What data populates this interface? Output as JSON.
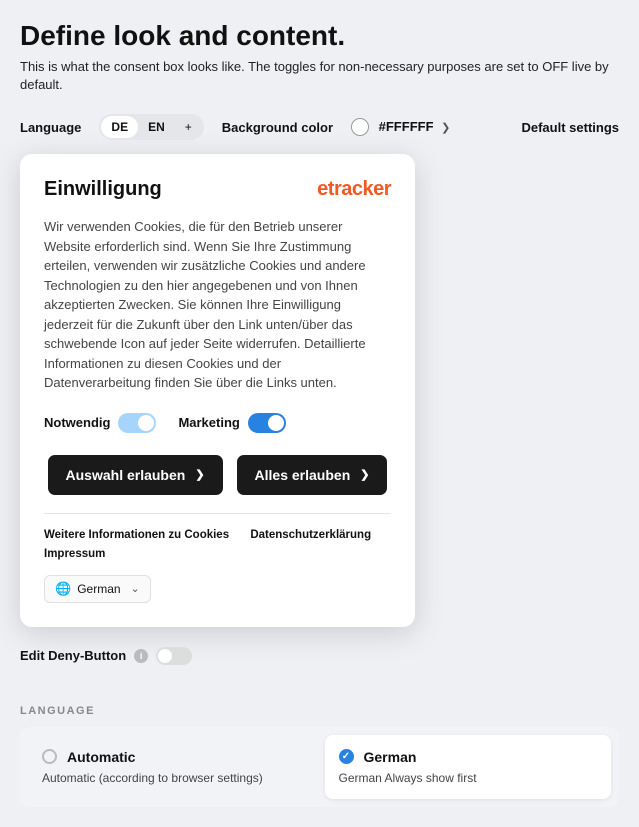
{
  "header": {
    "title": "Define look and content.",
    "subtitle": "This is what the consent box looks like. The toggles for non-necessary purposes are set to OFF live by default."
  },
  "toolbar": {
    "language_label": "Language",
    "lang_de": "DE",
    "lang_en": "EN",
    "lang_add": "+",
    "bg_label": "Background color",
    "bg_value": "#FFFFFF",
    "default_settings": "Default settings"
  },
  "consent": {
    "title": "Einwilligung",
    "brand": "etracker",
    "body": "Wir verwenden Cookies, die für den Betrieb unserer Website erforderlich sind. Wenn Sie Ihre Zustimmung erteilen, verwenden wir zusätzliche Cookies und andere Technologien zu den hier angegebenen und von Ihnen akzeptierten Zwecken. Sie können Ihre Einwilligung jederzeit für die Zukunft über den Link unten/über das schwebende Icon auf jeder Seite widerrufen. Detaillierte Informationen zu diesen Cookies und der Datenverarbeitung finden Sie über die Links unten.",
    "toggle_necessary": "Notwendig",
    "toggle_marketing": "Marketing",
    "btn_selection": "Auswahl erlauben",
    "btn_all": "Alles erlauben",
    "link_cookies": "Weitere Informationen zu Cookies",
    "link_privacy": "Datenschutzerklärung",
    "link_imprint": "Impressum",
    "lang_selector": "German"
  },
  "deny": {
    "label": "Edit Deny-Button"
  },
  "lang_section": {
    "label": "LANGUAGE",
    "auto_title": "Automatic",
    "auto_desc": "Automatic (according to browser settings)",
    "german_title": "German",
    "german_desc": "German Always show first"
  }
}
